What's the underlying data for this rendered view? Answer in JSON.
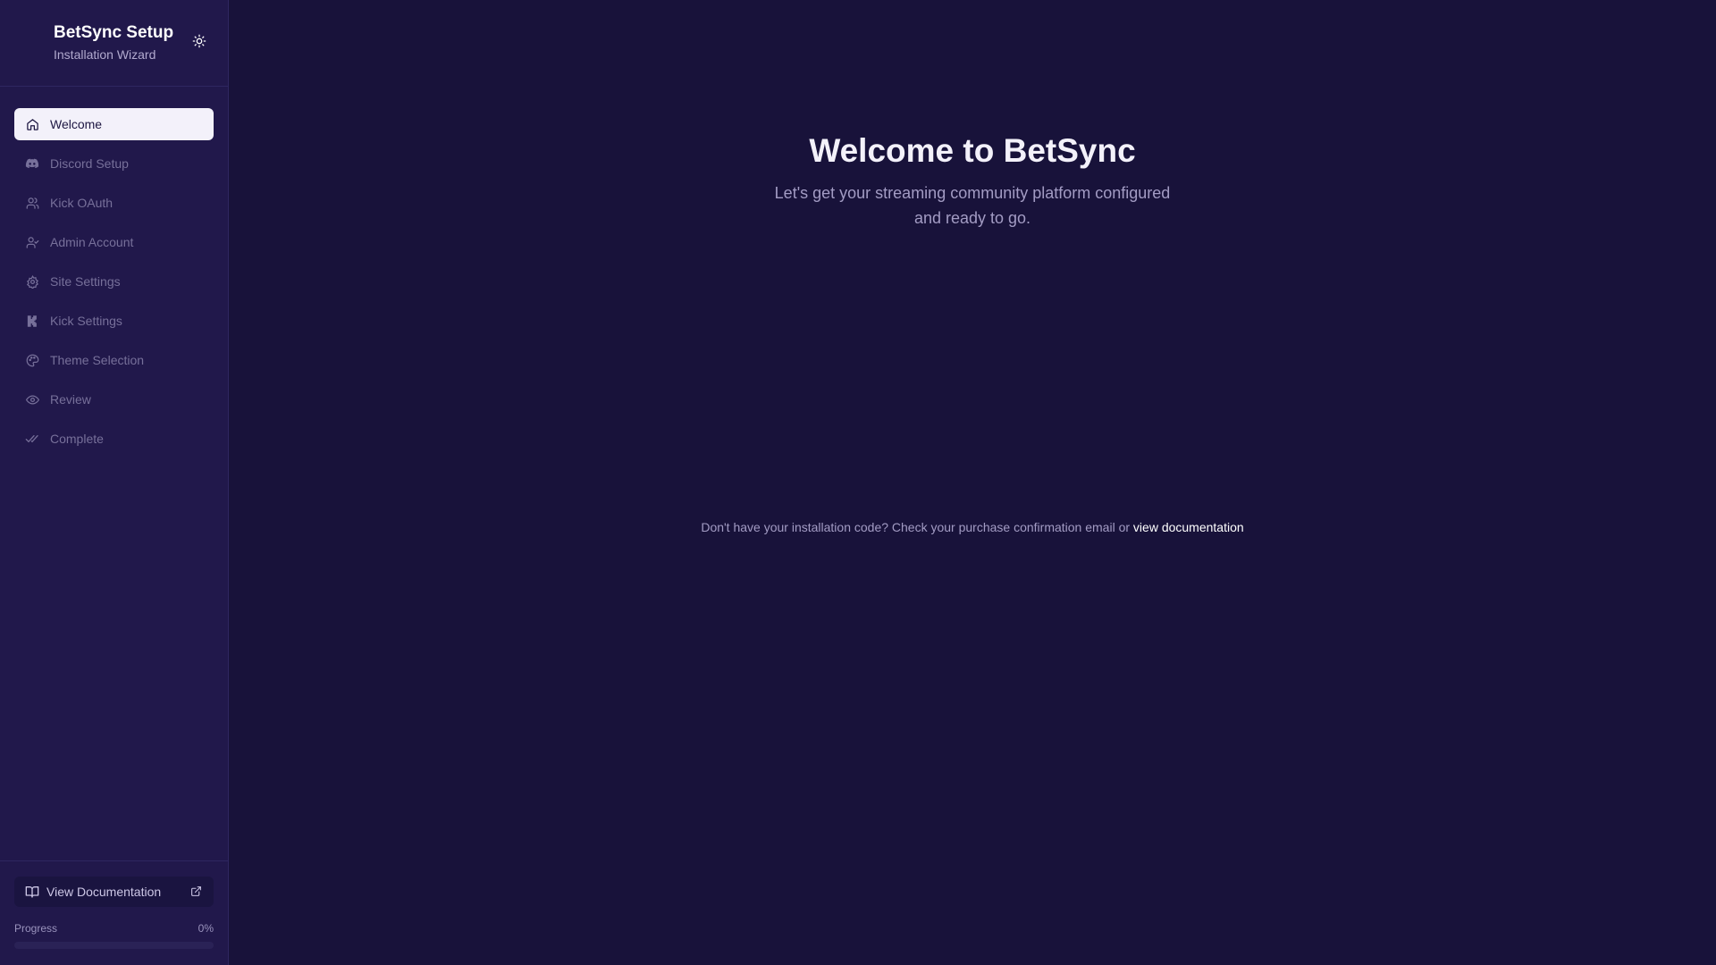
{
  "brand": {
    "title": "BetSync Setup",
    "subtitle": "Installation Wizard",
    "theme_toggle_icon": "sun-icon"
  },
  "nav": {
    "items": [
      {
        "label": "Welcome",
        "icon": "home-icon",
        "active": true
      },
      {
        "label": "Discord Setup",
        "icon": "discord-icon",
        "active": false
      },
      {
        "label": "Kick OAuth",
        "icon": "users-icon",
        "active": false
      },
      {
        "label": "Admin Account",
        "icon": "user-check-icon",
        "active": false
      },
      {
        "label": "Site Settings",
        "icon": "gear-icon",
        "active": false
      },
      {
        "label": "Kick Settings",
        "icon": "kick-logo-icon",
        "active": false
      },
      {
        "label": "Theme Selection",
        "icon": "palette-icon",
        "active": false
      },
      {
        "label": "Review",
        "icon": "eye-icon",
        "active": false
      },
      {
        "label": "Complete",
        "icon": "double-check-icon",
        "active": false
      }
    ]
  },
  "footer": {
    "doc_button_label": "View Documentation",
    "progress_label": "Progress",
    "progress_value": "0%",
    "progress_fraction": 0
  },
  "main": {
    "title": "Welcome to BetSync",
    "subtitle": "Let's get your streaming community platform configured and ready to go.",
    "helper_text": "Don't have your installation code? Check your purchase confirmation email or ",
    "helper_link": "view documentation"
  },
  "colors": {
    "background": "#18123a",
    "sidebar": "#21184b",
    "active_item_bg": "#f3f1fa",
    "muted_text": "#77709a"
  }
}
